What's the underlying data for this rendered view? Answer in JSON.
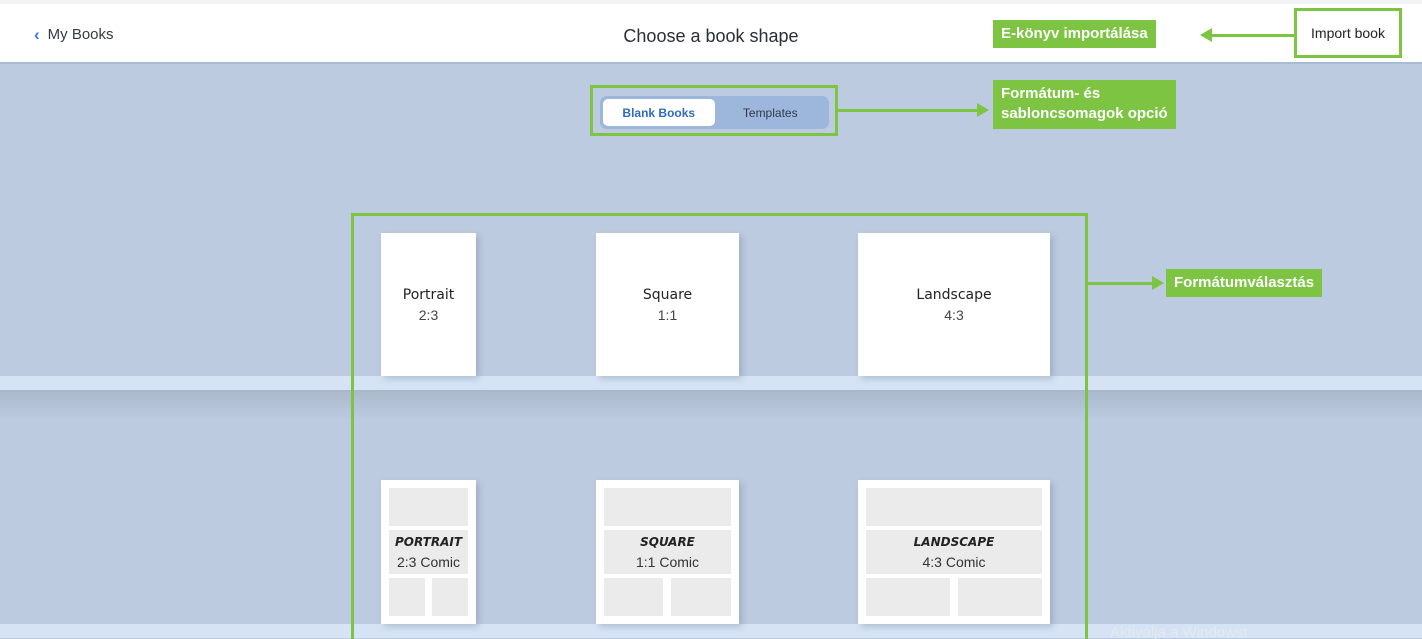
{
  "header": {
    "back_label": "My Books",
    "title": "Choose a book shape",
    "import_label": "Import book"
  },
  "tabs": {
    "blank": "Blank Books",
    "templates": "Templates",
    "active": "Blank Books"
  },
  "books": [
    {
      "name": "Portrait",
      "ratio": "2:3"
    },
    {
      "name": "Square",
      "ratio": "1:1"
    },
    {
      "name": "Landscape",
      "ratio": "4:3"
    }
  ],
  "comics": [
    {
      "name": "PORTRAIT",
      "ratio": "2:3 Comic"
    },
    {
      "name": "SQUARE",
      "ratio": "1:1 Comic"
    },
    {
      "name": "LANDSCAPE",
      "ratio": "4:3 Comic"
    }
  ],
  "annotations": {
    "import": "E-könyv importálása",
    "tabs_line1": "Formátum- és",
    "tabs_line2": "sabloncsomagok opció",
    "formats": "Formátumválasztás",
    "color": "#7dc443"
  },
  "watermark": "Aktiválja a Windowst"
}
